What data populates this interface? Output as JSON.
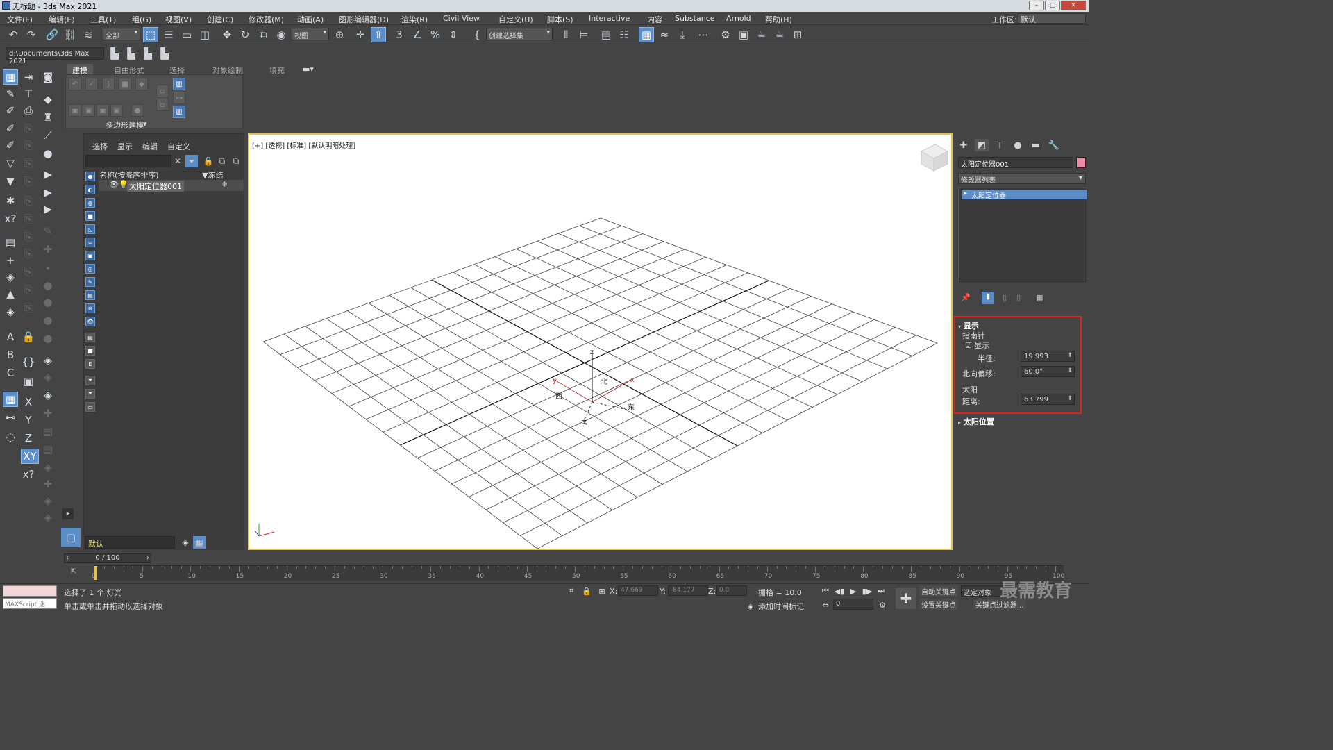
{
  "window": {
    "title": "无标题 - 3ds Max 2021"
  },
  "menu": [
    "文件(F)",
    "编辑(E)",
    "工具(T)",
    "组(G)",
    "视图(V)",
    "创建(C)",
    "修改器(M)",
    "动画(A)",
    "图形编辑器(D)",
    "渲染(R)",
    "Civil View",
    "自定义(U)",
    "脚本(S)",
    "Interactive",
    "内容",
    "Substance",
    "Arnold",
    "帮助(H)"
  ],
  "workspace": {
    "label": "工作区:",
    "value": "默认"
  },
  "toolbar": {
    "filter": "全部",
    "refcoord": "视图",
    "selset": "创建选择集"
  },
  "project_path": "d:\\Documents\\3ds Max 2021",
  "ribbon": {
    "tabs": [
      "建模",
      "自由形式",
      "选择",
      "对象绘制",
      "填充"
    ],
    "panel_label": "多边形建模"
  },
  "scene_explorer": {
    "menus": [
      "选择",
      "显示",
      "编辑",
      "自定义"
    ],
    "col_name": "名称(按降序排序)",
    "col_freeze": "▼冻结",
    "object": "太阳定位器001",
    "layer": "默认"
  },
  "viewport": {
    "label": "[+] [透视] [标准] [默认明暗处理]",
    "compass": {
      "n": "北",
      "s": "南",
      "e": "东",
      "w": "西"
    },
    "gizmo": {
      "x": "x",
      "y": "y",
      "z": "z"
    }
  },
  "command_panel": {
    "object_name": "太阳定位器001",
    "object_color": "#ea8aa6",
    "modifier_list": "修改器列表",
    "stack_item": "太阳定位器",
    "rollout_display": "显示",
    "compass_group": "指南针",
    "show_checkbox": "显示",
    "radius_label": "半径:",
    "radius_value": "19.993",
    "north_label": "北向偏移:",
    "north_value": "60.0°",
    "sun_group": "太阳",
    "distance_label": "距离:",
    "distance_value": "63.799",
    "rollout_sunpos": "太阳位置"
  },
  "timeline": {
    "frame": "0 / 100",
    "ticks": [
      "0",
      "5",
      "10",
      "15",
      "20",
      "25",
      "30",
      "35",
      "40",
      "45",
      "50",
      "55",
      "60",
      "65",
      "70",
      "75",
      "80",
      "85",
      "90",
      "95",
      "100"
    ]
  },
  "status": {
    "maxscript": "MAXScript 迷",
    "selected": "选择了 1 个 灯光",
    "hint": "单击或单击并拖动以选择对象",
    "x_label": "X:",
    "x_value": "47.669",
    "y_label": "Y:",
    "y_value": "-84.177",
    "z_label": "Z:",
    "z_value": "0.0",
    "grid": "栅格 = 10.0",
    "add_tag": "添加时间标记",
    "auto_key": "自动关键点",
    "set_key": "设置关键点",
    "selected_obj": "选定对象",
    "key_filter": "关键点过滤器...",
    "frame_val": "0"
  },
  "watermark": "最需教育",
  "accent": "#5b8dc8",
  "highlight_box": "#e0241a"
}
